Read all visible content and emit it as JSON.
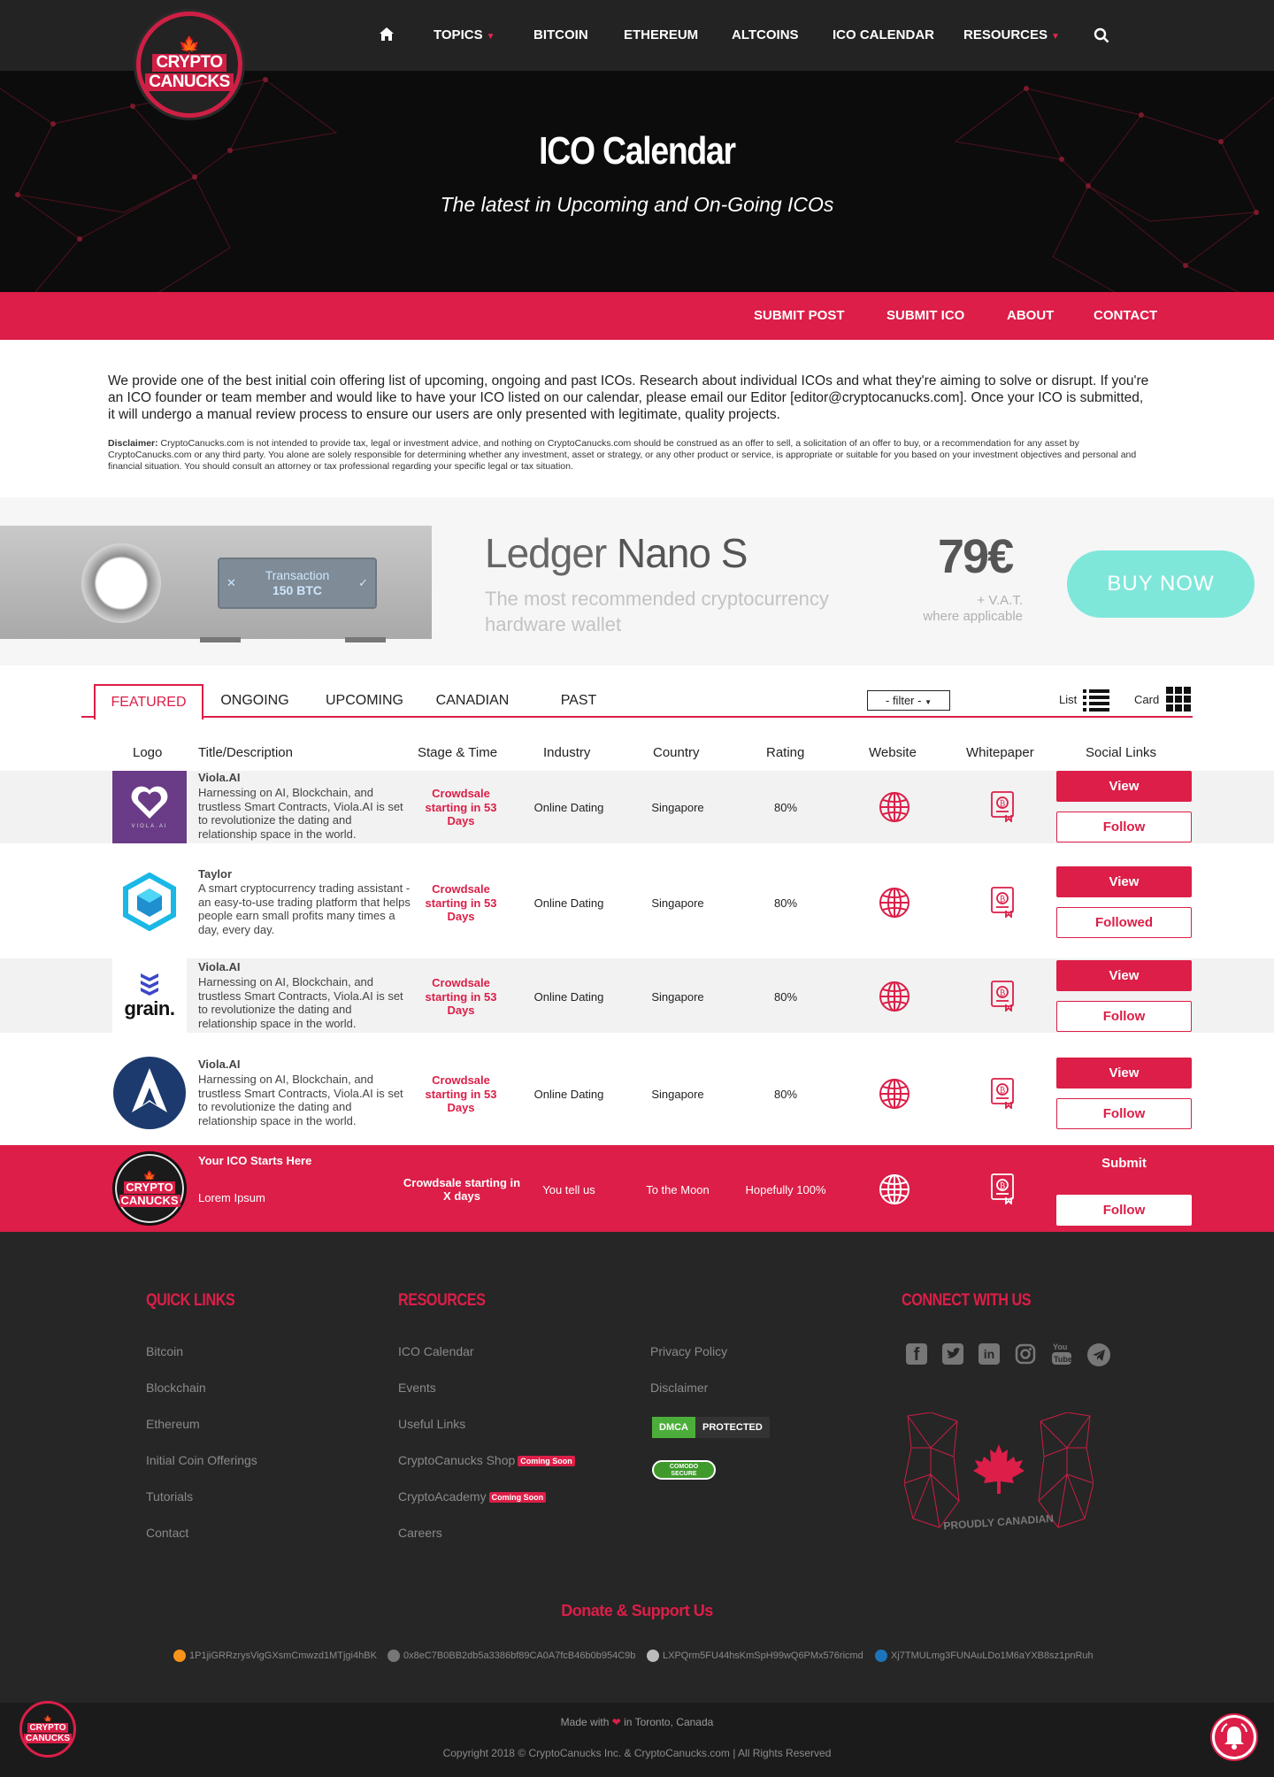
{
  "brand": {
    "line1": "CRYPTO",
    "line2": "CANUCKS",
    "leaf_icon": "maple-leaf-icon",
    "accent": "#dc1e48"
  },
  "nav": {
    "home_icon": "home-icon",
    "items": [
      "TOPICS",
      "BITCOIN",
      "ETHEREUM",
      "ALTCOINS",
      "ICO CALENDAR",
      "RESOURCES"
    ],
    "search_icon": "search-icon"
  },
  "hero": {
    "title": "ICO Calendar",
    "subtitle": "The latest in Upcoming and On-Going ICOs"
  },
  "subnav": [
    "SUBMIT POST",
    "SUBMIT ICO",
    "ABOUT",
    "CONTACT"
  ],
  "intro": "We provide one of the best initial coin offering list of upcoming, ongoing and past ICOs. Research about individual ICOs and what they're aiming to solve or disrupt. If you're an ICO founder or team member and would like to have your ICO listed on our calendar, please email our Editor [editor@cryptocanucks.com]. Once your ICO is submitted, it will undergo a manual review process to ensure our users are only presented with legitimate, quality projects.",
  "disclaimer": {
    "label": "Disclaimer:",
    "text": " CryptoCanucks.com is not intended to provide tax, legal or investment advice, and nothing on CryptoCanucks.com should be construed as an offer to sell, a solicitation of an offer to buy, or a recommendation for any asset by CryptoCanucks.com or any third party. You alone are solely responsible for determining whether any investment, asset or strategy, or any other product or service, is appropriate or suitable for you based on your investment objectives and personal and financial situation. You should consult an attorney or tax professional regarding your specific legal or tax situation."
  },
  "ad": {
    "screen_line1": "Transaction",
    "screen_line2": "150 BTC",
    "title_a": "Ledger",
    "title_b": "Nano S",
    "desc": "The most recommended cryptocurrency hardware wallet",
    "price": "79€",
    "vat1": "+ V.A.T.",
    "vat2": "where applicable",
    "cta": "BUY NOW"
  },
  "tabs": {
    "items": [
      "FEATURED",
      "ONGOING",
      "UPCOMING",
      "CANADIAN",
      "PAST"
    ],
    "active": "FEATURED",
    "filter": "- filter -",
    "list_label": "List",
    "card_label": "Card"
  },
  "table": {
    "headers": [
      "Logo",
      "Title/Description",
      "Stage & Time",
      "Industry",
      "Country",
      "Rating",
      "Website",
      "Whitepaper",
      "Social Links"
    ],
    "rows": [
      {
        "logo": "heart-logo",
        "title": "Viola.AI",
        "logo_text": "VIOLA.AI",
        "desc": "Harnessing on AI, Blockchain, and trustless Smart Contracts, Viola.AI is set to revolutionize the dating and relationship space in the world.",
        "stage": "Crowdsale starting in 53 Days",
        "industry": "Online Dating",
        "country": "Singapore",
        "rating": "80%",
        "view": "View",
        "follow": "Follow"
      },
      {
        "logo": "cube-logo",
        "title": "Taylor",
        "desc": "A smart cryptocurrency trading assistant - an easy-to-use trading platform that helps people earn small profits many times a day, every day.",
        "stage": "Crowdsale starting in 53 Days",
        "industry": "Online Dating",
        "country": "Singapore",
        "rating": "80%",
        "view": "View",
        "follow": "Followed"
      },
      {
        "logo": "grain-logo",
        "title": "Viola.AI",
        "logo_text": "grain.",
        "desc": "Harnessing on AI, Blockchain, and trustless Smart Contracts, Viola.AI is set to revolutionize the dating and relationship space in the world.",
        "stage": "Crowdsale starting in 53 Days",
        "industry": "Online Dating",
        "country": "Singapore",
        "rating": "80%",
        "view": "View",
        "follow": "Follow"
      },
      {
        "logo": "arrow-logo",
        "title": "Viola.AI",
        "desc": "Harnessing on AI, Blockchain, and trustless Smart Contracts, Viola.AI is set to revolutionize the dating and relationship space in the world.",
        "stage": "Crowdsale starting in 53 Days",
        "industry": "Online Dating",
        "country": "Singapore",
        "rating": "80%",
        "view": "View",
        "follow": "Follow"
      }
    ],
    "promo": {
      "title": "Your ICO Starts Here",
      "desc": "Lorem Ipsum",
      "stage": "Crowdsale starting in X days",
      "industry": "You tell us",
      "country": "To the Moon",
      "rating": "Hopefully 100%",
      "submit": "Submit",
      "follow": "Follow"
    }
  },
  "footer": {
    "quick_links": {
      "heading": "QUICK LINKS",
      "items": [
        "Bitcoin",
        "Blockchain",
        "Ethereum",
        "Initial Coin Offerings",
        "Tutorials",
        "Contact"
      ]
    },
    "resources": {
      "heading": "RESOURCES",
      "items": [
        "ICO Calendar",
        "Events",
        "Useful Links",
        "CryptoCanucks Shop",
        "CryptoAcademy",
        "Careers"
      ],
      "badge": "Coming Soon"
    },
    "legal": {
      "items": [
        "Privacy Policy",
        "Disclaimer"
      ],
      "dmca1": "DMCA",
      "dmca2": "PROTECTED",
      "comodo1": "COMODO",
      "comodo2": "SECURE"
    },
    "connect": {
      "heading": "CONNECT WITH US",
      "icons": [
        "facebook-icon",
        "twitter-icon",
        "linkedin-icon",
        "instagram-icon",
        "youtube-icon",
        "telegram-icon"
      ],
      "proud": "PROUDLY CANADIAN"
    },
    "donate": {
      "heading": "Donate & Support Us",
      "wallets": [
        {
          "coin": "bitcoin-icon",
          "color": "#f7931a",
          "address": "1P1jiGRRzrysVigGXsmCmwzd1MTjgi4hBK"
        },
        {
          "coin": "ethereum-icon",
          "color": "#777777",
          "address": "0x8eC7B0BB2db5a3386bf89CA0A7fcB46b0b954C9b"
        },
        {
          "coin": "litecoin-icon",
          "color": "#bbbbbb",
          "address": "LXPQrm5FU44hsKmSpH99wQ6PMx576ricmd"
        },
        {
          "coin": "dash-icon",
          "color": "#1c75bc",
          "address": "Xj7TMULmg3FUNAuLDo1M6aYXB8sz1pnRuh"
        }
      ]
    },
    "made_a": "Made with",
    "made_b": "in Toronto, Canada",
    "copyright": "Copyright 2018 © CryptoCanucks Inc. & CryptoCanucks.com | All Rights Reserved"
  }
}
